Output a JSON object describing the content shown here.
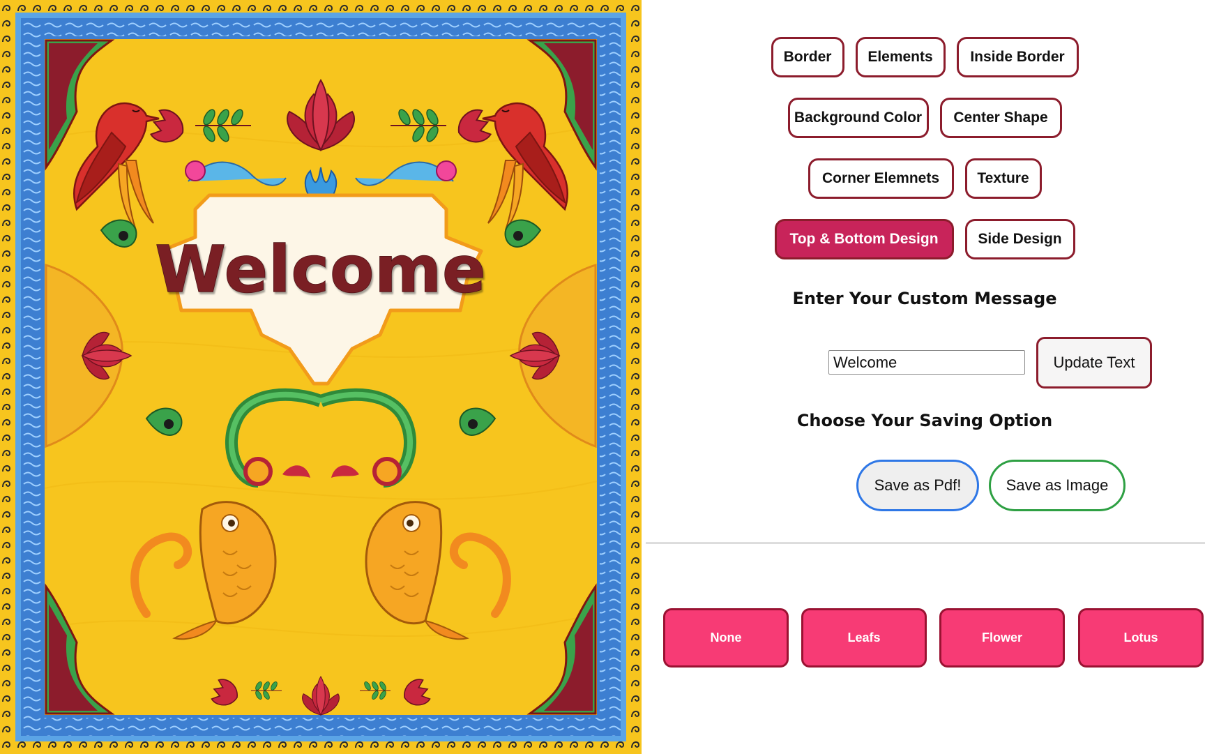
{
  "card": {
    "message": "Welcome",
    "colors": {
      "background": "#f7c51e",
      "frame_blue": "#3d7fd1",
      "frame_yellow": "#f7c51e",
      "message_color": "#7a1f24",
      "message_panel": "#fdf6e7",
      "bird_red": "#d9302c",
      "flower_red": "#c9283f",
      "leaf_green": "#3aa24a",
      "fish_orange": "#f6a623"
    },
    "decor_icons": [
      "bird-icon",
      "lotus-icon",
      "tulip-icon",
      "fish-icon",
      "paisley-icon",
      "swirl-icon"
    ]
  },
  "panel": {
    "option_rows": [
      [
        "Border",
        "Elements",
        "Inside Border"
      ],
      [
        "Background Color",
        "Center Shape"
      ],
      [
        "Corner Elemnets",
        "Texture"
      ],
      [
        "Top & Bottom Design",
        "Side Design"
      ]
    ],
    "active_option": "Top & Bottom Design",
    "custom_message_heading": "Enter Your Custom Message",
    "message_input_value": "Welcome",
    "update_button": "Update Text",
    "saving_heading": "Choose Your Saving Option",
    "save_pdf_button": "Save as Pdf!",
    "save_image_button": "Save as Image",
    "design_options": [
      "None",
      "Leafs",
      "Flower",
      "Lotus"
    ],
    "colors": {
      "button_border": "#8c1c2c",
      "active_button": "#c8245a",
      "design_button": "#f73b75",
      "pdf_border": "#2e77e6",
      "image_border": "#2ea043"
    }
  }
}
